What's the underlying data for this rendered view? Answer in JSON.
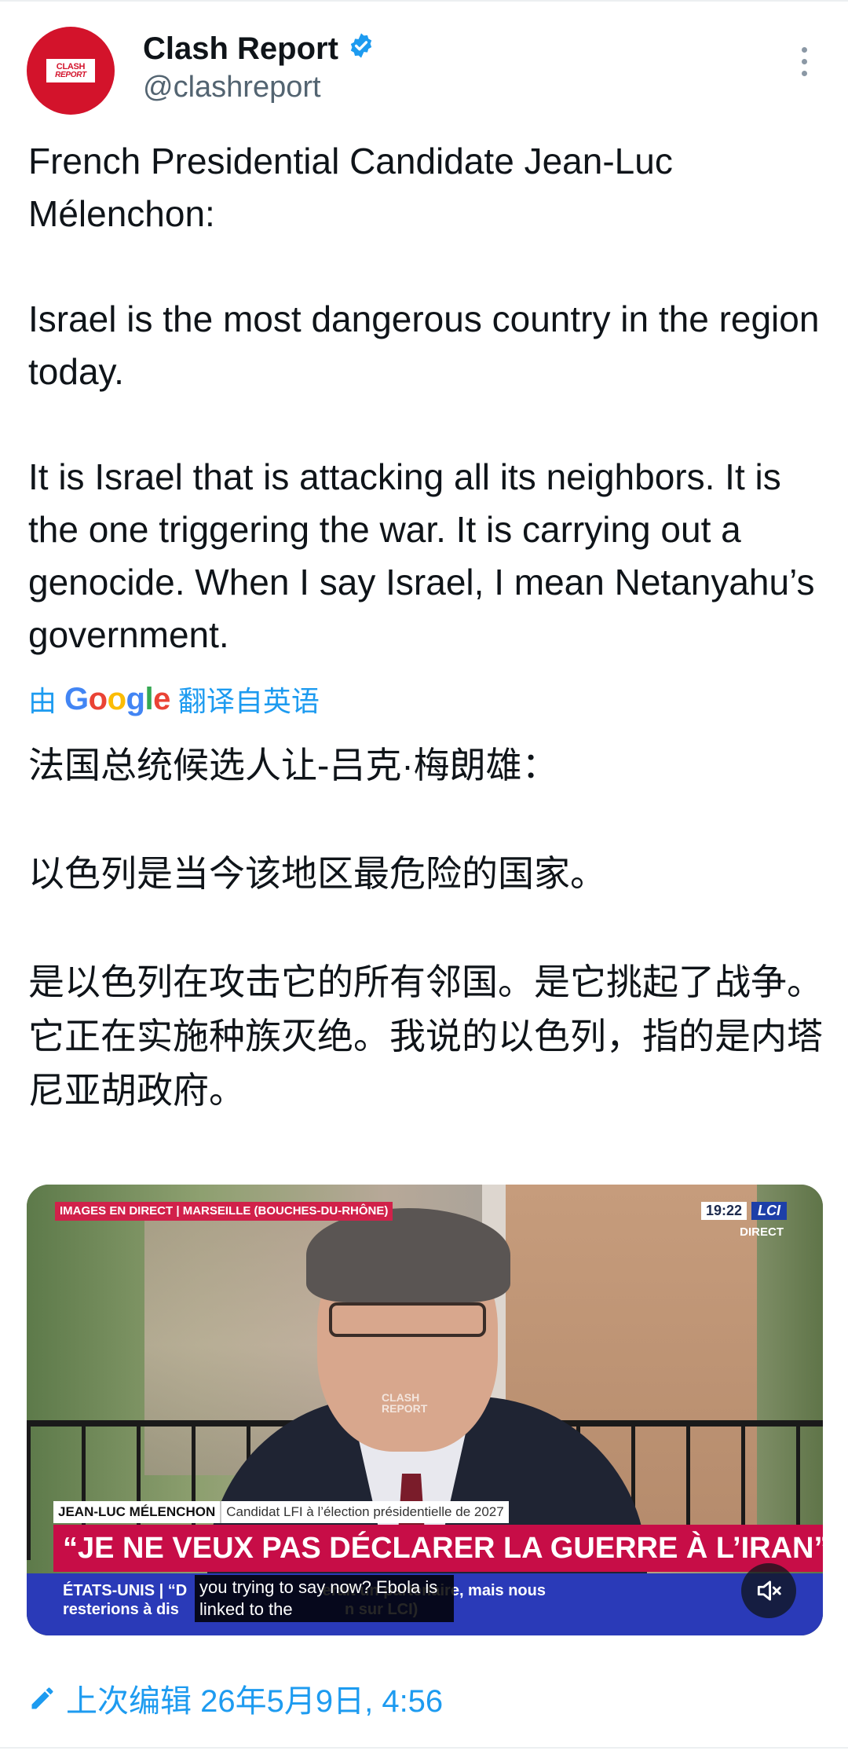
{
  "account": {
    "name": "Clash Report",
    "handle": "@clashreport",
    "avatar_logo_top": "CLASH",
    "avatar_logo_bottom": "REPORT",
    "verified": true,
    "verified_color": "#1d9bf0",
    "brand_color": "#d3132b"
  },
  "post": {
    "paragraphs": [
      "French Presidential Candidate Jean-Luc Mélenchon:",
      "Israel is the most dangerous country in the region today.",
      "It is Israel that is attacking all its neighbors. It is the one triggering the war. It is carrying out a genocide. When I say Israel, I mean Netanyahu’s government."
    ]
  },
  "translation": {
    "prefix": "由",
    "google": "Google",
    "suffix": "翻译自英语",
    "paragraphs": [
      "法国总统候选人让-吕克·梅朗雄：",
      "以色列是当今该地区最危险的国家。",
      "是以色列在攻击它的所有邻国。是它挑起了战争。它正在实施种族灭绝。我说的以色列，指的是内塔尼亚胡政府。"
    ]
  },
  "media": {
    "tag": "IMAGES EN DIRECT | MARSEILLE (BOUCHES-DU-RHÔNE)",
    "clock": "19:22",
    "channel": "LCI",
    "direct": "DIRECT",
    "watermark_top": "CLASH",
    "watermark_bottom": "REPORT",
    "speaker_name": "JEAN-LUC MÉLENCHON",
    "speaker_desc": "Candidat LFI à l’élection présidentielle de 2027",
    "headline": "“JE NE VEUX PAS DÉCLARER LA GUERRE À L’IRAN”",
    "ticker_line1": "ÉTATS-UNIS | “D                               erait un partenaire, mais nous",
    "ticker_line2": "resterions à dis                                      n sur LCI)",
    "caption": "you trying to say now? Ebola is linked to the",
    "mute_icon": "speaker-muted-icon"
  },
  "footer": {
    "edited_label": "上次编辑 26年5月9日, 4:56",
    "edit_icon": "pencil-icon"
  },
  "colors": {
    "link": "#1d9bf0",
    "secondary_text": "#536471",
    "headline_bg": "#c70d47",
    "ticker_bg": "#2a3ab8"
  }
}
